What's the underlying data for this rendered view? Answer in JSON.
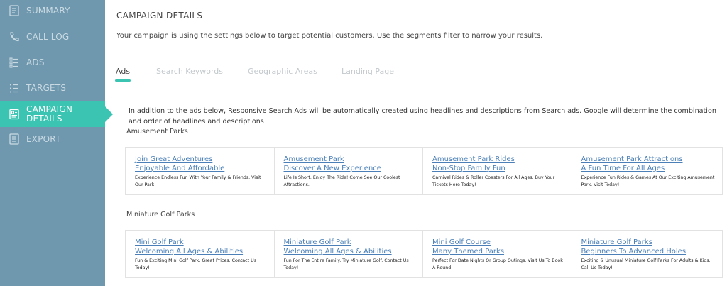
{
  "sidebar": {
    "items": [
      {
        "label": "SUMMARY",
        "icon": "summary-icon"
      },
      {
        "label": "CALL LOG",
        "icon": "phone-icon"
      },
      {
        "label": "ADS",
        "icon": "ads-icon"
      },
      {
        "label": "TARGETS",
        "icon": "targets-icon"
      },
      {
        "label_line1": "CAMPAIGN",
        "label_line2": "DETAILS",
        "icon": "campaign-details-icon",
        "active": true
      },
      {
        "label": "EXPORT",
        "icon": "export-icon"
      }
    ]
  },
  "header": {
    "title": "CAMPAIGN DETAILS",
    "description": "Your campaign is using the settings below to target potential customers. Use the segments filter to narrow your results."
  },
  "tabs": [
    {
      "label": "Ads",
      "active": true
    },
    {
      "label": "Search Keywords"
    },
    {
      "label": "Geographic Areas"
    },
    {
      "label": "Landing Page"
    }
  ],
  "info_text": "In addition to the ads below, Responsive Search Ads will be automatically created using headlines and descriptions from Search ads. Google will determine the combination and order of headlines and descriptions",
  "groups": [
    {
      "title": "Amusement Parks",
      "ads": [
        {
          "headline1": "Join Great Adventures",
          "headline2": "Enjoyable And Affordable",
          "description": "Experience Endless Fun With Your Family & Friends. Visit Our Park!"
        },
        {
          "headline1": "Amusement Park",
          "headline2": "Discover A New Experience",
          "description": "Life Is Short. Enjoy The Ride! Come See Our Coolest Attractions."
        },
        {
          "headline1": "Amusement Park Rides",
          "headline2": "Non-Stop Family Fun",
          "description": "Carnival Rides & Roller Coasters For All Ages. Buy Your Tickets Here Today!"
        },
        {
          "headline1": "Amusement Park Attractions",
          "headline2": "A Fun Time For All Ages",
          "description": "Experience Fun Rides & Games At Our Exciting Amusement Park. Visit Today!"
        }
      ]
    },
    {
      "title": "Miniature Golf Parks",
      "ads": [
        {
          "headline1": "Mini Golf Park",
          "headline2": "Welcoming All Ages & Abilities",
          "description": "Fun & Exciting Mini Golf Park. Great Prices. Contact Us Today!"
        },
        {
          "headline1": "Miniature Golf Park",
          "headline2": "Welcoming All Ages & Abilities",
          "description": "Fun For The Entire Family. Try Miniature Golf. Contact Us Today!"
        },
        {
          "headline1": "Mini Golf Course",
          "headline2": "Many Themed Parks",
          "description": "Perfect For Date Nights Or Group Outings. Visit Us To Book A Round!"
        },
        {
          "headline1": "Miniature Golf Parks",
          "headline2": "Beginners To Advanced Holes",
          "description": "Exciting & Unusual Miniature Golf Parks For Adults & Kids. Call Us Today!"
        }
      ]
    }
  ],
  "colors": {
    "sidebar_bg": "#6f98ae",
    "sidebar_text": "#c9dae3",
    "accent": "#3cc4b2",
    "link": "#4a7fb7"
  }
}
